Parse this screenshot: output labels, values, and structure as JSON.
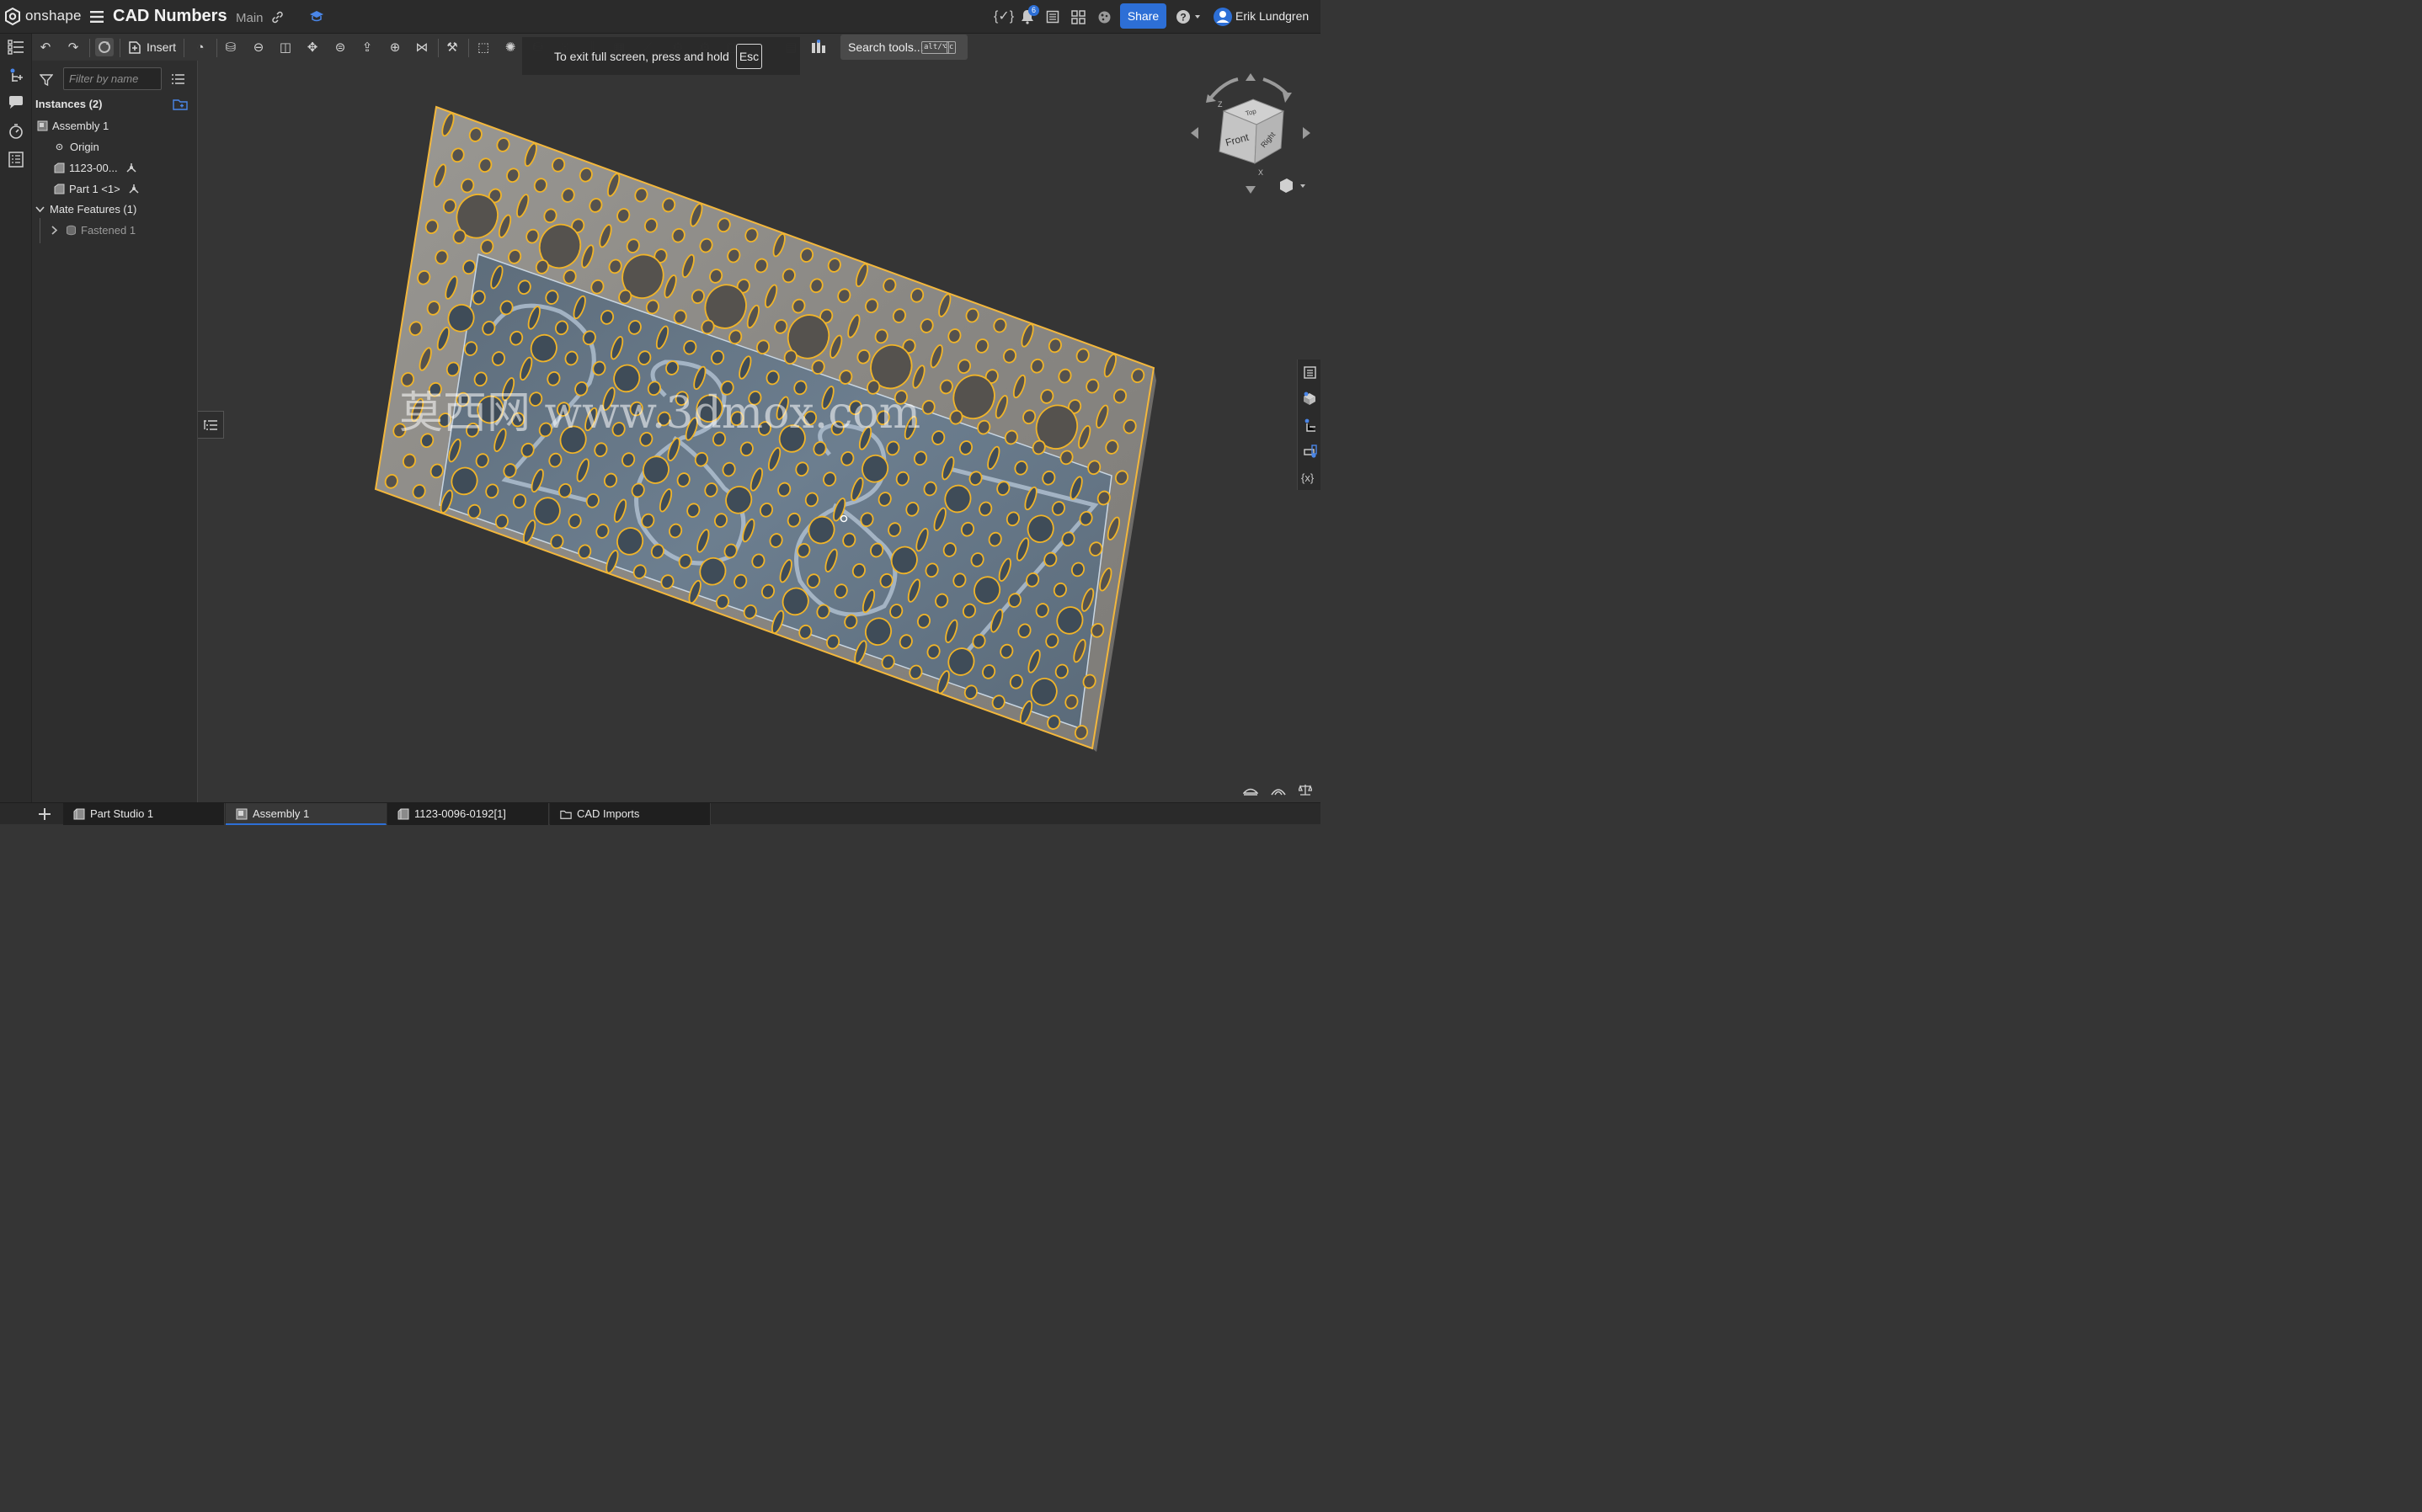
{
  "app": {
    "logo": "onshape",
    "doc_title": "CAD Numbers",
    "branch": "Main"
  },
  "header": {
    "share_label": "Share",
    "notifications_count": "6",
    "user_name": "Erik Lundgren"
  },
  "toolbar": {
    "insert_label": "Insert",
    "search_label": "Search tools...",
    "search_shortcut_1": "alt/⌥",
    "search_shortcut_2": "c"
  },
  "toast": {
    "message": "To exit full screen, press and hold",
    "key": "Esc"
  },
  "panel": {
    "filter_placeholder": "Filter by name",
    "instances_header": "Instances (2)",
    "tree": {
      "assembly": "Assembly 1",
      "origin": "Origin",
      "part_a": "1123-00...",
      "part_b": "Part 1 <1>",
      "mates_header": "Mate Features (1)",
      "mate_item": "Fastened 1"
    }
  },
  "viewcube": {
    "front": "Front",
    "right": "Right",
    "top": "Top",
    "axis_z": "Z",
    "axis_x": "X"
  },
  "watermark": "莫西网 www.3dmox.com",
  "tabs": [
    {
      "label": "Part Studio 1",
      "icon": "part-studio-icon"
    },
    {
      "label": "Assembly 1",
      "icon": "assembly-icon"
    },
    {
      "label": "1123-0096-0192[1]",
      "icon": "part-studio-icon"
    },
    {
      "label": "CAD Imports",
      "icon": "folder-icon"
    }
  ],
  "colors": {
    "accent": "#2d6fd6",
    "plate_outer": "#8c8a86",
    "plate_inner": "#66788a",
    "hole_edge": "#f0b429",
    "background": "#353535"
  }
}
